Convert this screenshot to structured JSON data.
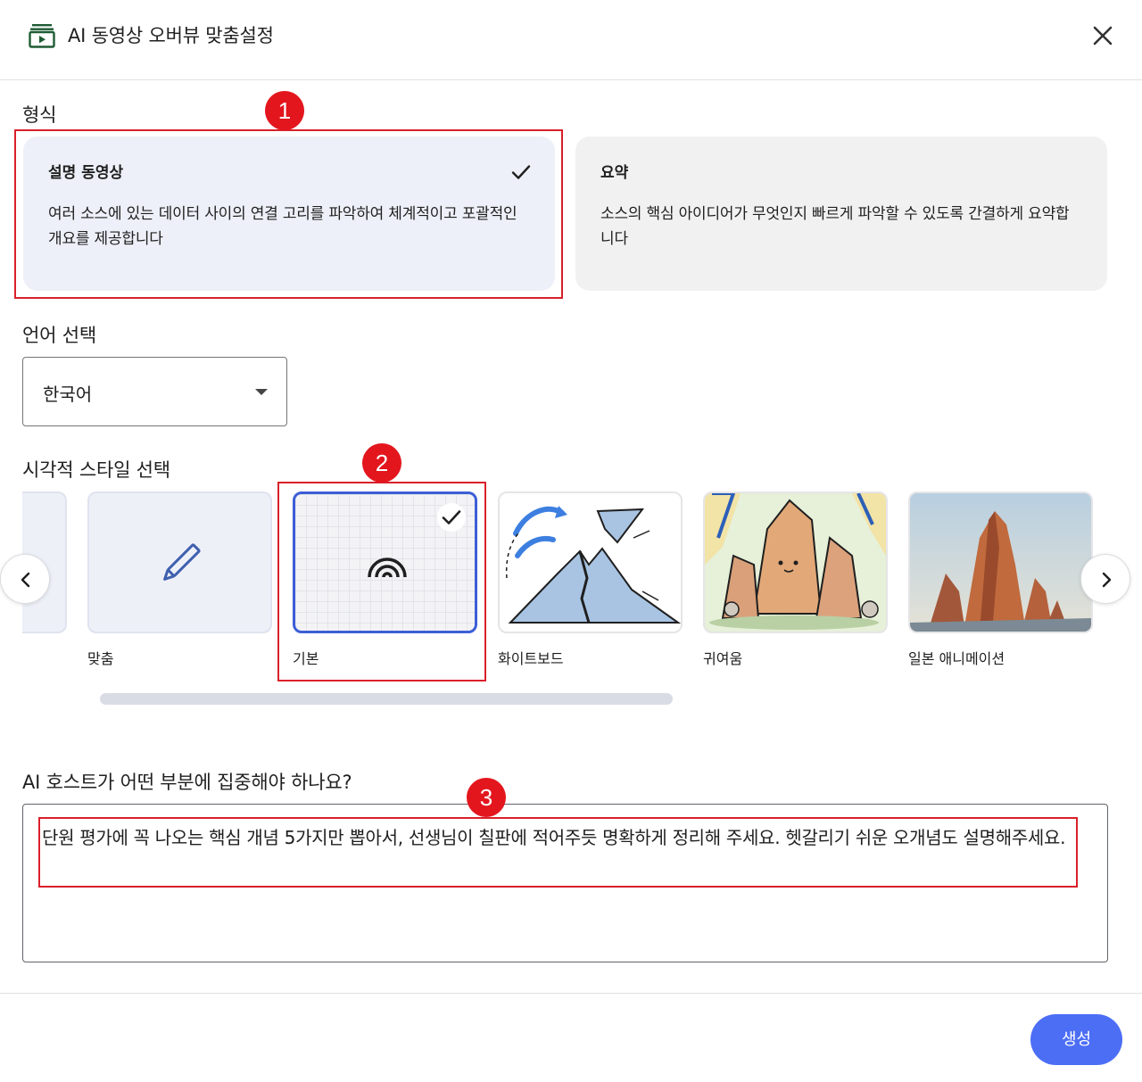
{
  "header": {
    "title": "AI 동영상 오버뷰 맞춤설정",
    "app_icon": "video-stack-icon",
    "close_icon": "close-icon"
  },
  "format": {
    "label": "형식",
    "cards": [
      {
        "title": "설명 동영상",
        "desc": "여러 소스에 있는 데이터 사이의 연결 고리를 파악하여 체계적이고 포괄적인 개요를 제공합니다",
        "selected": true
      },
      {
        "title": "요약",
        "desc": "소스의 핵심 아이디어가 무엇인지 빠르게 파악할 수 있도록 간결하게 요약합니다",
        "selected": false
      }
    ]
  },
  "language": {
    "label": "언어 선택",
    "selected": "한국어"
  },
  "visual_style": {
    "label": "시각적 스타일 선택",
    "tiles": [
      {
        "label": "맞춤",
        "icon": "pencil-icon"
      },
      {
        "label": "기본",
        "icon": "rainbow-arcs-icon",
        "selected": true
      },
      {
        "label": "화이트보드"
      },
      {
        "label": "귀여움"
      },
      {
        "label": "일본 애니메이션"
      }
    ]
  },
  "focus": {
    "label": "AI 호스트가 어떤 부분에 집중해야 하나요?",
    "value": "단원 평가에 꼭 나오는 핵심 개념 5가지만 뽑아서, 선생님이 칠판에 적어주듯 명확하게 정리해 주세요. 헷갈리기 쉬운 오개념도 설명해주세요."
  },
  "annotations": [
    "1",
    "2",
    "3"
  ],
  "actions": {
    "generate": "생성"
  },
  "colors": {
    "accent": "#4c6ef5",
    "selected_card": "#edf0f8",
    "annotation_red": "#e3161e"
  }
}
